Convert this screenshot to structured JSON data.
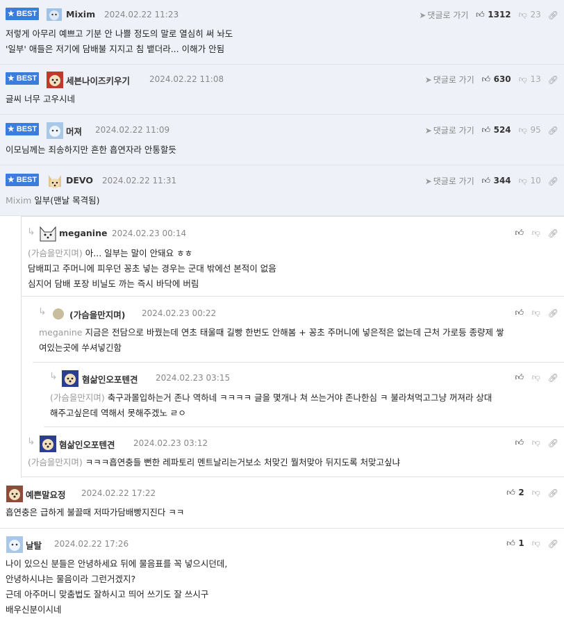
{
  "labels": {
    "best": "★ BEST",
    "reply": "댓글로 가기"
  },
  "comments": [
    {
      "best": true,
      "nick": "Mixim",
      "date": "2024.02.22 11:23",
      "up": "1312",
      "down": "23",
      "lines": [
        "저렇게 아무리 예쁘고 기분 안 나쁠 정도의 말로 열심히 써 놔도",
        "'일부' 애들은 저기에 담배불 지지고 침 뱉더라... 이해가 안됨"
      ]
    },
    {
      "best": true,
      "nick": "세븐나이즈키우기",
      "date": "2024.02.22 11:08",
      "up": "630",
      "down": "13",
      "lines": [
        "글씨 너무 고우시네"
      ]
    },
    {
      "best": true,
      "nick": "머져",
      "date": "2024.02.22 11:09",
      "up": "524",
      "down": "95",
      "lines": [
        "이모님께는 죄송하지만 흔한 흡연자라 안통할듯"
      ]
    },
    {
      "best": true,
      "nick": "DEVO",
      "date": "2024.02.22 11:31",
      "up": "344",
      "down": "10",
      "mention": "Mixim",
      "lines": [
        "일부(맨날 목격됨)"
      ]
    }
  ],
  "replies": [
    {
      "nick": "meganine",
      "date": "2024.02.23 00:14",
      "mention": "(가슴을만지며)",
      "lines": [
        "아... 일부는 말이 안돼요 ㅎㅎ",
        "담배피고 주머니에 피우던 꽁초 넣는 경우는 군대 밖에선 본적이 없음",
        "심지어 담배 포장 비닐도 까는 즉시 바닥에 버림"
      ]
    },
    {
      "nick": "(가슴을만지며)",
      "date": "2024.02.23 00:22",
      "mention": "meganine",
      "lines": [
        "지금은 전담으로 바꿨는데 연초 태울때 길빵 한번도 안해봄 + 꽁초 주머니에 넣은적은 없는데 근처 가로등 종량제 쌓",
        "여있는곳에 쑤셔넣긴함"
      ]
    },
    {
      "nick": "혐삶인오포텐견",
      "date": "2024.02.23 03:15",
      "mention": "(가슴을만지며)",
      "lines": [
        "축구과몰입하는거 존나 역하네 ㅋㅋㅋㅋ 글을 몇개나 쳐 쓰는거야 존나한심 ㅋ 불라쳐먹고그냥 꺼져라 상대",
        "해주고싶은데 역해서 못해주겠노 ㄹㅇ"
      ]
    },
    {
      "nick": "혐삶인오포텐견",
      "date": "2024.02.23 03:12",
      "mention": "(가슴을만지며)",
      "lines": [
        "ㅋㅋㅋ흡연충들 뻔한 레파토리 멘트날리는거보소 처맞긴 뭘처맞아 뒤지도록 처맞고싶냐"
      ]
    }
  ],
  "normal": [
    {
      "nick": "예쁜말요정",
      "date": "2024.02.22 17:22",
      "up": "2",
      "lines": [
        "흡연충은 급하게 불끌때 저따가담배빵지진다 ㅋㅋ"
      ]
    },
    {
      "nick": "날탈",
      "date": "2024.02.22 17:26",
      "up": "1",
      "lines": [
        "나이 있으신 분들은 안녕하세요 뒤에 물음표를 꼭 넣으시던데,",
        "안녕하시냐는 물음이라 그런거겠지?",
        "근데 아주머니 맞춤법도 잘하시고 띄어 쓰기도 잘 쓰시구",
        "배우신분이시네"
      ]
    }
  ]
}
